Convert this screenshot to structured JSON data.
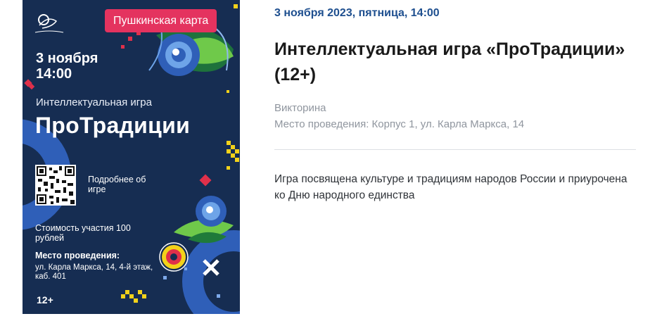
{
  "poster": {
    "badge": "Пушкинская карта",
    "date_time": "3 ноября\n14:00",
    "subtitle": "Интеллектуальная игра",
    "title": "ПроТрадиции",
    "more_info": "Подробнее об игре",
    "cost": "Стоимость участия 100 рублей",
    "venue_label": "Место проведения:",
    "venue": "ул. Карла Маркса, 14, 4-й этаж, каб. 401",
    "age": "12+",
    "colors": {
      "background": "#162d52",
      "badge": "#e4335f",
      "accent_blue": "#2f5fb8",
      "accent_yellow": "#f3d21a",
      "accent_red": "#e0304a"
    }
  },
  "event": {
    "datetime": "3 ноября 2023, пятница, 14:00",
    "title": "Интеллектуальная игра «ПроТрадиции» (12+)",
    "type": "Викторина",
    "location": "Место проведения: Корпус 1, ул. Карла Маркса, 14",
    "description": "Игра посвящена культуре и традициям народов России и приурочена ко Дню народного единства"
  },
  "icons": [
    "org-logo-icon",
    "qr-code-icon"
  ]
}
